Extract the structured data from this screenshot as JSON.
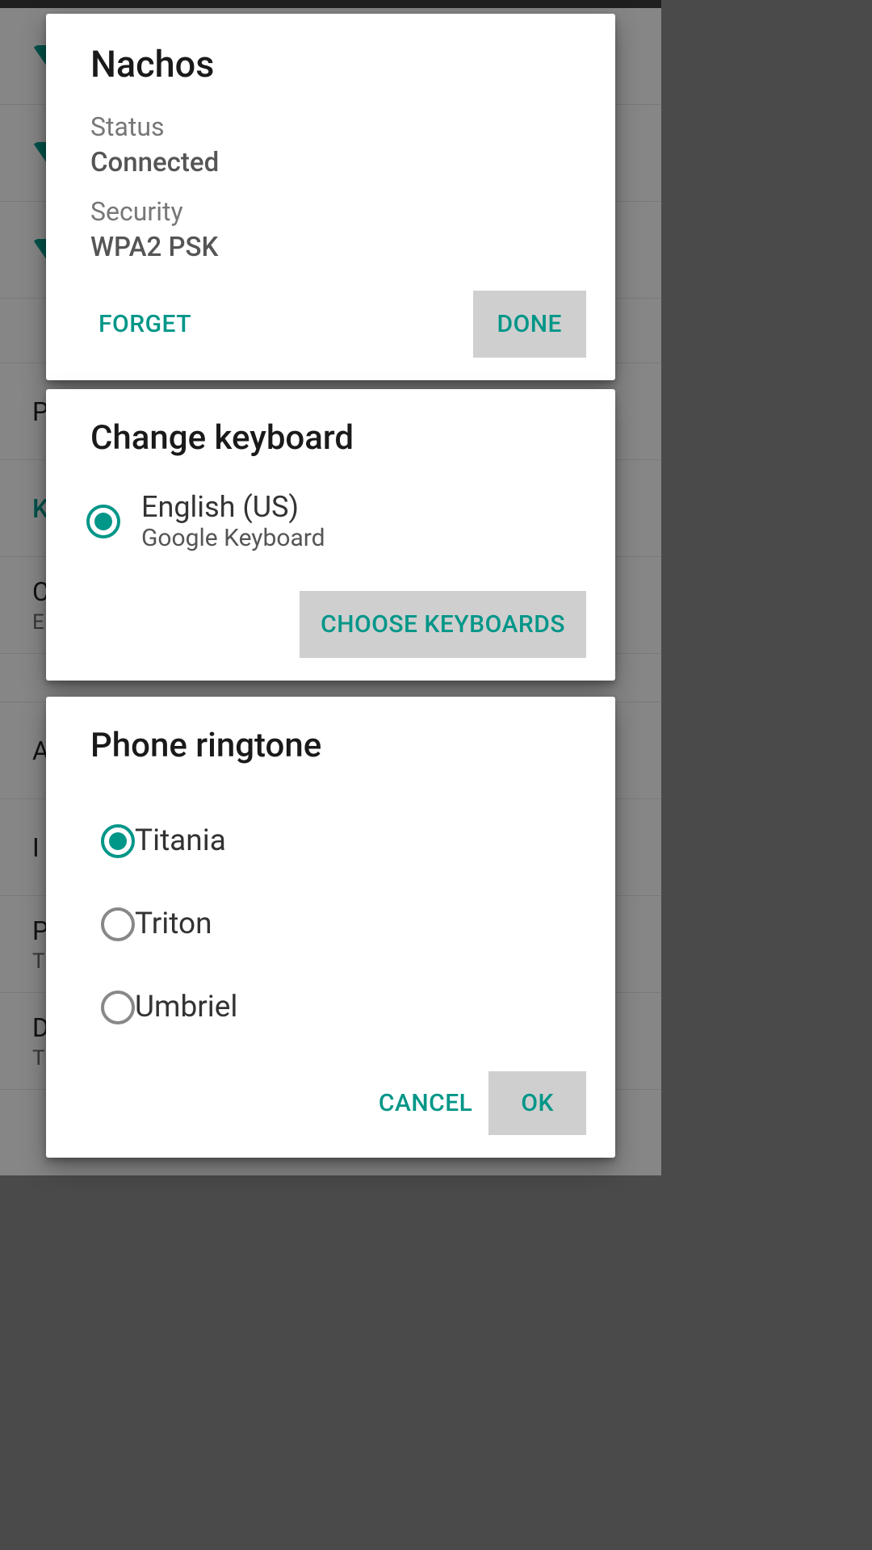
{
  "background": {
    "items": [
      {
        "label": "",
        "sub": ""
      },
      {
        "label": "A",
        "sub": ""
      },
      {
        "label": "I",
        "sub": ""
      },
      {
        "label": "P",
        "sub": "T"
      },
      {
        "label": "D",
        "sub": "T"
      }
    ],
    "p_label": "P",
    "k_label": "K",
    "c_label": "C",
    "e_label": "E"
  },
  "wifi_dialog": {
    "title": "Nachos",
    "status_label": "Status",
    "status_value": "Connected",
    "security_label": "Security",
    "security_value": "WPA2 PSK",
    "forget": "FORGET",
    "done": "DONE"
  },
  "keyboard_dialog": {
    "title": "Change keyboard",
    "option_primary": "English (US)",
    "option_secondary": "Google Keyboard",
    "choose": "CHOOSE KEYBOARDS"
  },
  "ringtone_dialog": {
    "title": "Phone ringtone",
    "options": [
      {
        "name": "Titania",
        "selected": true
      },
      {
        "name": "Triton",
        "selected": false
      },
      {
        "name": "Umbriel",
        "selected": false
      }
    ],
    "cancel": "CANCEL",
    "ok": "OK"
  }
}
